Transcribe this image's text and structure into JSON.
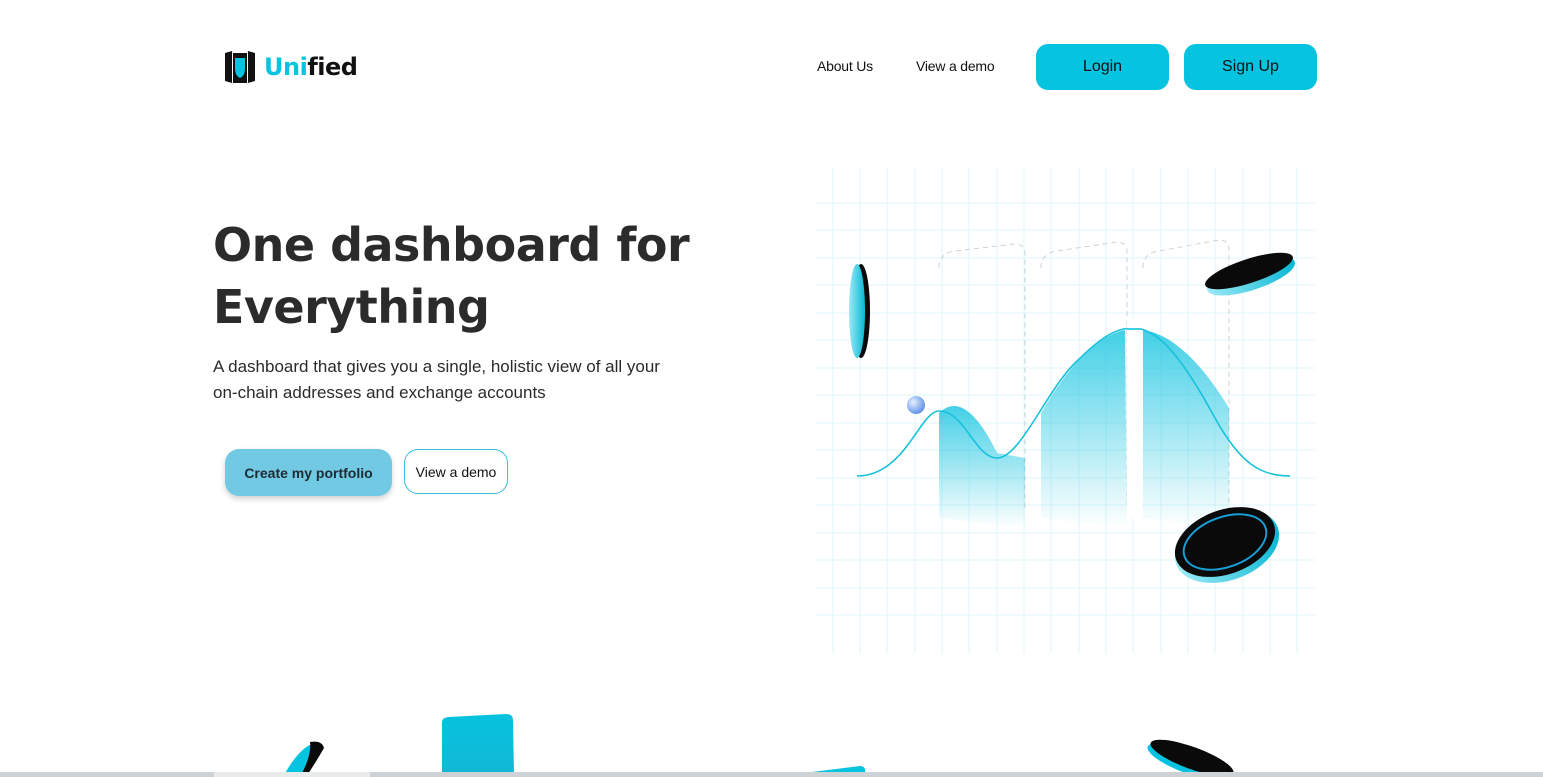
{
  "brand": {
    "name_accent": "Uni",
    "name_rest": "fied",
    "accent_color": "#06c3df",
    "logo_icon": "shield-book-icon"
  },
  "nav": {
    "about": "About Us",
    "demo": "View a demo",
    "login": "Login",
    "signup": "Sign Up"
  },
  "hero": {
    "title_line1": "One dashboard for",
    "title_line2": "Everything",
    "subtitle": "A dashboard that gives you a single, holistic view of all your on-chain addresses and exchange accounts",
    "cta_primary": "Create my portfolio",
    "cta_secondary": "View a demo"
  },
  "colors": {
    "primary": "#06c3df",
    "cta_primary": "#72c9e3",
    "text": "#2b2b2b",
    "grid": "#e3f7fa"
  }
}
